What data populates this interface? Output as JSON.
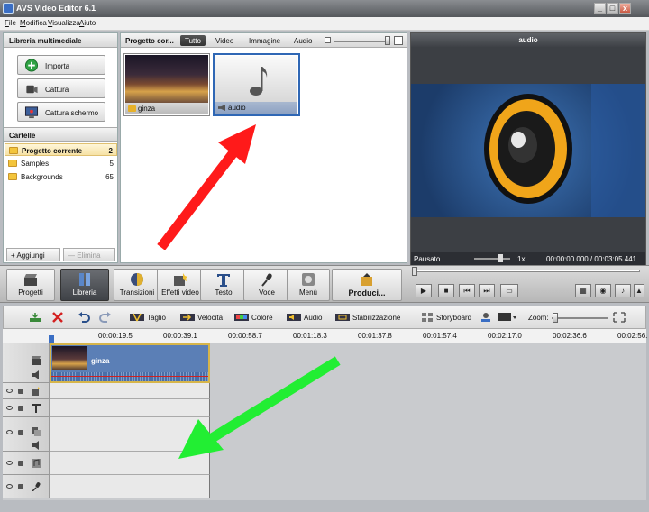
{
  "window": {
    "title": "AVS Video Editor 6.1",
    "controls": [
      "_",
      "□",
      "x"
    ]
  },
  "menu": [
    "File",
    "Modifica",
    "Visualizza",
    "Aiuto"
  ],
  "library": {
    "header": "Libreria multimediale",
    "buttons": [
      {
        "label": "Importa"
      },
      {
        "label": "Cattura"
      },
      {
        "label": "Cattura schermo"
      }
    ],
    "folders_header": "Cartelle",
    "folders": [
      {
        "name": "Progetto corrente",
        "count": "2"
      },
      {
        "name": "Samples",
        "count": "5"
      },
      {
        "name": "Backgrounds",
        "count": "65"
      }
    ],
    "add_label": "+ Aggiungi",
    "remove_label": "— Elimina"
  },
  "media": {
    "header": "Progetto cor...",
    "tabs": [
      "Tutto",
      "Video",
      "Immagine",
      "Audio"
    ],
    "items": [
      {
        "name": "ginza",
        "kind": "video"
      },
      {
        "name": "audio",
        "kind": "audio"
      }
    ]
  },
  "preview": {
    "title": "audio",
    "status": "Pausato",
    "speed": "1x",
    "time": "00:00:00.000 / 00:03:05.441"
  },
  "toolbar": {
    "items": [
      "Progetti",
      "Libreria",
      "Transizioni",
      "Effetti video",
      "Testo",
      "Voce",
      "Menù",
      "Produci..."
    ],
    "selected": "Libreria"
  },
  "timeline_tools": {
    "items": [
      "Taglio",
      "Velocità",
      "Colore",
      "Audio",
      "Stabilizzazione"
    ],
    "storyboard": "Storyboard",
    "zoom": "Zoom:"
  },
  "ruler": [
    "00:00:19.5",
    "00:00:39.1",
    "00:00:58.7",
    "00:01:18.3",
    "00:01:37.8",
    "00:01:57.4",
    "00:02:17.0",
    "00:02:36.6",
    "00:02:56."
  ],
  "timeline": {
    "clip_name": "ginza"
  },
  "colors": {
    "accent": "#2f67b5",
    "selected_tab": "#3a3c40",
    "red_arrow": "#ff1a1a",
    "green_arrow": "#22ee33"
  }
}
